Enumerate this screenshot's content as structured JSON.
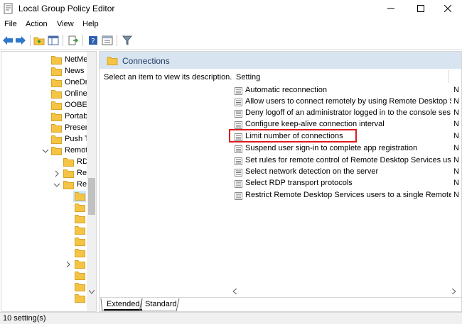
{
  "window": {
    "title": "Local Group Policy Editor"
  },
  "menu": {
    "file": "File",
    "action": "Action",
    "view": "View",
    "help": "Help"
  },
  "toolbar": {
    "icons": [
      "back-arrow-icon",
      "forward-arrow-icon",
      "up-folder-icon",
      "show-hide-tree-icon",
      "export-list-icon",
      "help-icon",
      "properties-icon",
      "filter-icon"
    ]
  },
  "tree": {
    "items": [
      {
        "label": "NetMe"
      },
      {
        "label": "News a"
      },
      {
        "label": "OneDr"
      },
      {
        "label": "Online"
      },
      {
        "label": "OOBE"
      },
      {
        "label": "Portab"
      },
      {
        "label": "Presen"
      },
      {
        "label": "Push T"
      },
      {
        "label": "Remot"
      },
      {
        "label": "RD"
      },
      {
        "label": "Rer"
      },
      {
        "label": "Rer"
      }
    ]
  },
  "right": {
    "header_title": "Connections",
    "description": "Select an item to view its description.",
    "column_setting": "Setting",
    "settings": [
      {
        "text": "Automatic reconnection",
        "state": "N"
      },
      {
        "text": "Allow users to connect remotely by using Remote Desktop S...",
        "state": "N"
      },
      {
        "text": "Deny logoff of an administrator logged in to the console ses...",
        "state": "N"
      },
      {
        "text": "Configure keep-alive connection interval",
        "state": "N"
      },
      {
        "text": "Limit number of connections",
        "state": "N"
      },
      {
        "text": "Suspend user sign-in to complete app registration",
        "state": "N"
      },
      {
        "text": "Set rules for remote control of Remote Desktop Services use...",
        "state": "N"
      },
      {
        "text": "Select network detection on the server",
        "state": "N"
      },
      {
        "text": "Select RDP transport protocols",
        "state": "N"
      },
      {
        "text": "Restrict Remote Desktop Services users to a single Remote D...",
        "state": "N"
      }
    ],
    "tab_extended": "Extended",
    "tab_standard": "Standard"
  },
  "status": {
    "text": "10 setting(s)"
  },
  "colors": {
    "header_band": "#d9e4f1",
    "highlight": "#e0191c",
    "folder": "#f5c444"
  }
}
